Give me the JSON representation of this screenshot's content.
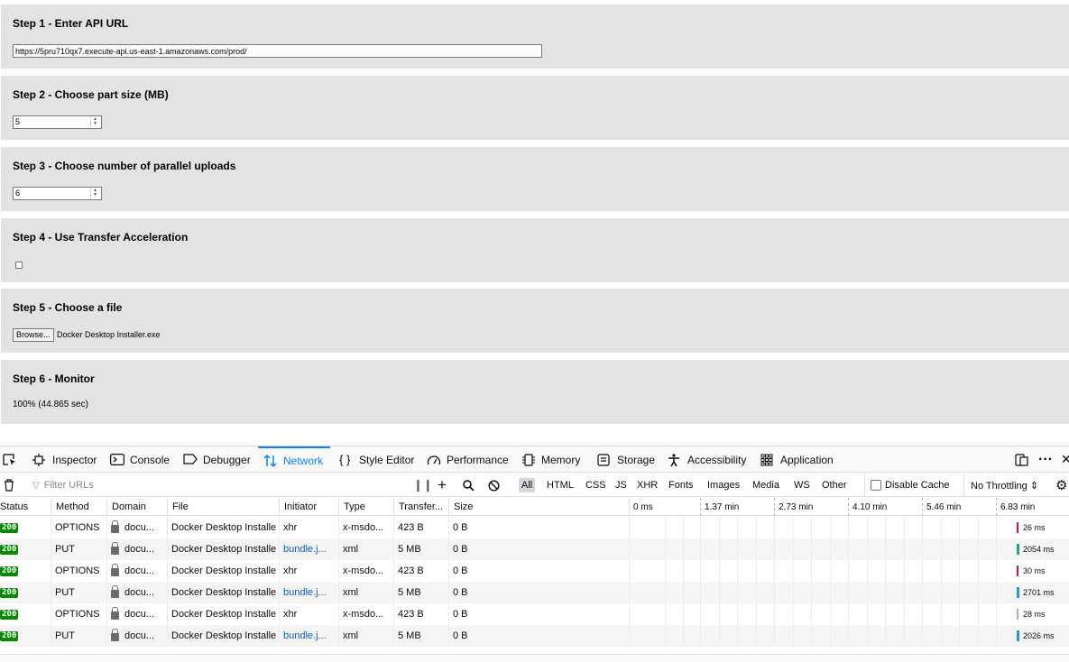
{
  "steps": {
    "s1": {
      "title": "Step 1 - Enter API URL",
      "url": "https://5pru710qx7.execute-api.us-east-1.amazonaws.com/prod/"
    },
    "s2": {
      "title": "Step 2 - Choose part size (MB)",
      "value": "5"
    },
    "s3": {
      "title": "Step 3 - Choose number of parallel uploads",
      "value": "6"
    },
    "s4": {
      "title": "Step 4 - Use Transfer Acceleration",
      "checked": false
    },
    "s5": {
      "title": "Step 5 - Choose a file",
      "browse": "Browse...",
      "file": "Docker Desktop Installer.exe"
    },
    "s6": {
      "title": "Step 6 - Monitor",
      "progress": "100% (44.865 sec)"
    }
  },
  "devtools": {
    "tabs": {
      "inspector": "Inspector",
      "console": "Console",
      "debugger": "Debugger",
      "network": "Network",
      "style_editor": "Style Editor",
      "performance": "Performance",
      "memory": "Memory",
      "storage": "Storage",
      "accessibility": "Accessibility",
      "application": "Application"
    },
    "active_tab": "Network",
    "filter_placeholder": "Filter URLs",
    "type_filters": [
      "All",
      "HTML",
      "CSS",
      "JS",
      "XHR",
      "Fonts",
      "Images",
      "Media",
      "WS",
      "Other"
    ],
    "selected_filter": "All",
    "disable_cache": "Disable Cache",
    "throttling": "No Throttling ⇕",
    "columns": {
      "status": "Status",
      "method": "Method",
      "domain": "Domain",
      "file": "File",
      "initiator": "Initiator",
      "type": "Type",
      "transferred": "Transfer...",
      "size": "Size"
    },
    "timeline_ticks": [
      "0 ms",
      "1.37 min",
      "2.73 min",
      "4.10 min",
      "5.46 min",
      "6.83 min"
    ],
    "rows": [
      {
        "status": "200",
        "method": "OPTIONS",
        "domain": "docu...",
        "file": "Docker Desktop Installe",
        "initiator": "xhr",
        "type": "x-msdo...",
        "transferred": "423 B",
        "size": "0 B",
        "timing": "26 ms",
        "bar_color": "#c0184a"
      },
      {
        "status": "200",
        "method": "PUT",
        "domain": "docu...",
        "file": "Docker Desktop Installe",
        "initiator": "bundle.j...",
        "type": "xml",
        "transferred": "5 MB",
        "size": "0 B",
        "timing": "2054 ms",
        "bar_color": "#20a58c"
      },
      {
        "status": "200",
        "method": "OPTIONS",
        "domain": "docu...",
        "file": "Docker Desktop Installe",
        "initiator": "xhr",
        "type": "x-msdo...",
        "transferred": "423 B",
        "size": "0 B",
        "timing": "30 ms",
        "bar_color": "#c0184a"
      },
      {
        "status": "200",
        "method": "PUT",
        "domain": "docu...",
        "file": "Docker Desktop Installe",
        "initiator": "bundle.j...",
        "type": "xml",
        "transferred": "5 MB",
        "size": "0 B",
        "timing": "2701 ms",
        "bar_color": "#2f95d6"
      },
      {
        "status": "200",
        "method": "OPTIONS",
        "domain": "docu...",
        "file": "Docker Desktop Installe",
        "initiator": "xhr",
        "type": "x-msdo...",
        "transferred": "423 B",
        "size": "0 B",
        "timing": "28 ms",
        "bar_color": "#a8a8c8"
      },
      {
        "status": "200",
        "method": "PUT",
        "domain": "docu...",
        "file": "Docker Desktop Installe",
        "initiator": "bundle.j...",
        "type": "xml",
        "transferred": "5 MB",
        "size": "0 B",
        "timing": "2026 ms",
        "bar_color": "#2f95d6"
      }
    ]
  }
}
